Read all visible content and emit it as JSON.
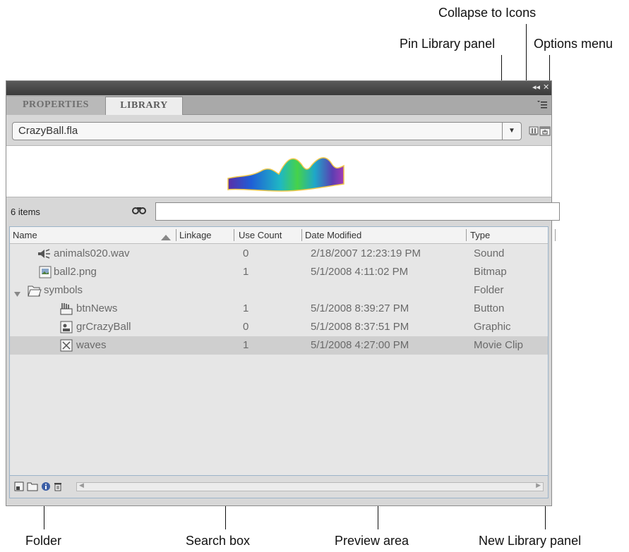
{
  "callouts": {
    "collapse": "Collapse to Icons",
    "pin": "Pin Library panel",
    "options": "Options menu",
    "folder": "Folder",
    "search": "Search box",
    "preview": "Preview area",
    "new_library": "New Library panel"
  },
  "titlebar": {
    "collapse_glyph": "◂◂",
    "close_glyph": "✕"
  },
  "tabs": [
    {
      "label": "PROPERTIES",
      "active": false
    },
    {
      "label": "LIBRARY",
      "active": true
    }
  ],
  "document": {
    "selected": "CrazyBall.fla"
  },
  "search": {
    "count": "6 items",
    "value": ""
  },
  "columns": {
    "name": "Name",
    "linkage": "Linkage",
    "use_count": "Use Count",
    "date_modified": "Date Modified",
    "type": "Type"
  },
  "rows": [
    {
      "name": "animals020.wav",
      "use_count": "0",
      "date": "2/18/2007 12:23:19 PM",
      "type": "Sound",
      "icon": "sound-icon"
    },
    {
      "name": "ball2.png",
      "use_count": "1",
      "date": "5/1/2008 4:11:02 PM",
      "type": "Bitmap",
      "icon": "bitmap-icon"
    },
    {
      "name": "symbols",
      "use_count": "",
      "date": "",
      "type": "Folder",
      "icon": "open-folder-icon"
    },
    {
      "name": "btnNews",
      "use_count": "1",
      "date": "5/1/2008 8:39:27 PM",
      "type": "Button",
      "icon": "button-symbol-icon"
    },
    {
      "name": "grCrazyBall",
      "use_count": "0",
      "date": "5/1/2008 8:37:51 PM",
      "type": "Graphic",
      "icon": "graphic-symbol-icon"
    },
    {
      "name": "waves",
      "use_count": "1",
      "date": "5/1/2008 4:27:00 PM",
      "type": "Movie Clip",
      "icon": "movieclip-symbol-icon",
      "selected": true
    }
  ],
  "colors": {
    "panel_bg": "#d7d7d7",
    "titlebar": "#3f3f3f",
    "list_border": "#9bb3c9",
    "selected_row": "#cfcfcf"
  }
}
